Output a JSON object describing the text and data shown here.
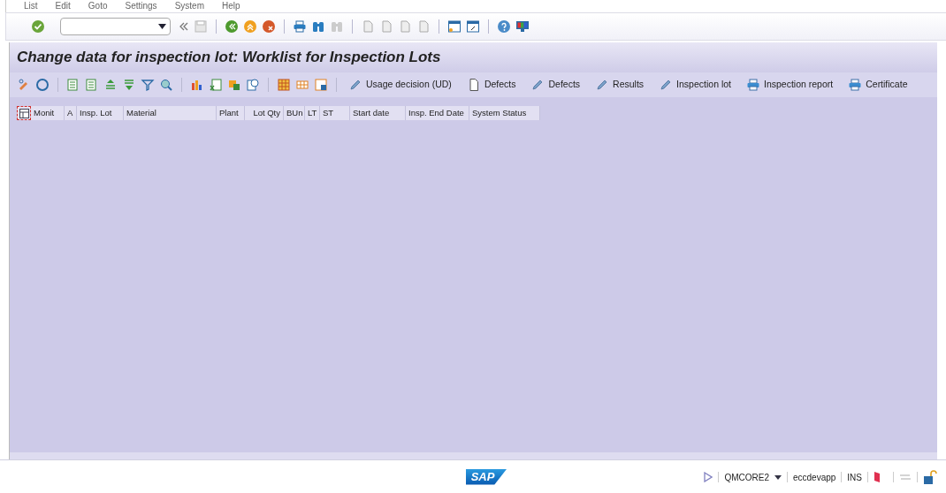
{
  "menu_bar": [
    "List",
    "Edit",
    "Goto",
    "Settings",
    "System",
    "Help"
  ],
  "title": "Change data for inspection lot: Worklist for Inspection Lots",
  "app_toolbar": [
    {
      "label": "Usage decision (UD)",
      "kind": "pencil"
    },
    {
      "label": "Defects",
      "kind": "page"
    },
    {
      "label": "Defects",
      "kind": "pencil"
    },
    {
      "label": "Results",
      "kind": "pencil"
    },
    {
      "label": "Inspection lot",
      "kind": "pencil"
    },
    {
      "label": "Inspection report",
      "kind": "printer"
    },
    {
      "label": "Certificate",
      "kind": "printer"
    }
  ],
  "table": {
    "columns": [
      "Monit",
      "A",
      "Insp. Lot",
      "Material",
      "Plant",
      "Lot Qty",
      "BUn",
      "LT",
      "ST",
      "Start date",
      "Insp. End Date",
      "System Status"
    ]
  },
  "logo": "SAP",
  "status_bar": {
    "system": "QMCORE2",
    "server": "eccdevapp",
    "mode": "INS"
  }
}
